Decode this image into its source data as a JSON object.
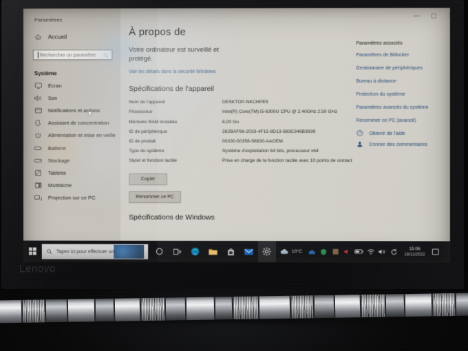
{
  "device": {
    "brand": "Lenovo"
  },
  "settings_window": {
    "title": "Paramètres",
    "titlebar": {
      "minimize": "—",
      "maximize": "▢",
      "close": "✕"
    },
    "nav": {
      "home_label": "Accueil",
      "search_placeholder": "Rechercher un paramètre",
      "search_value": "",
      "section_label": "Système",
      "items": [
        {
          "label": "Écran",
          "icon": "monitor-icon"
        },
        {
          "label": "Son",
          "icon": "speaker-icon"
        },
        {
          "label": "Notifications et actions",
          "icon": "notification-icon"
        },
        {
          "label": "Assistant de concentration",
          "icon": "moon-icon"
        },
        {
          "label": "Alimentation et mise en veille",
          "icon": "power-icon"
        },
        {
          "label": "Batterie",
          "icon": "battery-icon"
        },
        {
          "label": "Stockage",
          "icon": "storage-icon"
        },
        {
          "label": "Tablette",
          "icon": "tablet-icon"
        },
        {
          "label": "Multitâche",
          "icon": "multitask-icon"
        },
        {
          "label": "Projection sur ce PC",
          "icon": "projection-icon"
        }
      ]
    },
    "main": {
      "page_title": "À propos de",
      "protection_status": "Votre ordinateur est surveillé et protégé.",
      "security_link": "Voir les détails dans la sécurité Windows",
      "device_specs_heading": "Spécifications de l'appareil",
      "specs": [
        {
          "key": "Nom de l'appareil",
          "value": "DESKTOP-NKCHPE5"
        },
        {
          "key": "Processeur",
          "value": "Intel(R) Core(TM) i5-6300U CPU @ 2.40GHz   2.50 GHz"
        },
        {
          "key": "Mémoire RAM installée",
          "value": "8,00 Go"
        },
        {
          "key": "ID de périphérique",
          "value": "262BAF66-2033-4F15-8D13-583C346B3839"
        },
        {
          "key": "ID de produit",
          "value": "00330-50358-56830-AAOEM"
        },
        {
          "key": "Type du système",
          "value": "Système d'exploitation 64 bits, processeur x64"
        },
        {
          "key": "Stylet et fonction tactile",
          "value": "Prise en charge de la fonction tactile avec 10 points de contact"
        }
      ],
      "copy_button": "Copier",
      "rename_button": "Renommer ce PC",
      "windows_specs_heading": "Spécifications de Windows"
    },
    "related": {
      "title": "Paramètres associés",
      "links": [
        "Paramètres de Bitlocker",
        "Gestionnaire de périphériques",
        "Bureau à distance",
        "Protection du système",
        "Paramètres avancés du système",
        "Renommer ce PC (avancé)"
      ],
      "help": [
        {
          "label": "Obtenir de l'aide",
          "icon": "help-icon"
        },
        {
          "label": "Donner des commentaires",
          "icon": "feedback-icon"
        }
      ]
    }
  },
  "taskbar": {
    "start_label": "Démarrer",
    "search_placeholder": "Tapez ici pour effectuer une",
    "pinned": [
      {
        "name": "cortana-icon"
      },
      {
        "name": "task-view-icon"
      },
      {
        "name": "edge-icon"
      },
      {
        "name": "file-explorer-icon"
      },
      {
        "name": "microsoft-store-icon"
      },
      {
        "name": "mail-icon"
      },
      {
        "name": "settings-icon"
      }
    ],
    "weather_temp": "10°C",
    "tray": [
      {
        "name": "onedrive-icon"
      },
      {
        "name": "security-icon"
      },
      {
        "name": "app-tray-icon"
      },
      {
        "name": "media-icon"
      },
      {
        "name": "battery-icon"
      },
      {
        "name": "network-icon"
      },
      {
        "name": "volume-icon"
      },
      {
        "name": "sync-icon"
      }
    ],
    "clock_time": "15:06",
    "clock_date": "18/11/2022"
  },
  "colors": {
    "link": "#2b4f78",
    "screen_bg": "#cbc8c2",
    "taskbar": "#15161a",
    "bezel": "#141416"
  }
}
